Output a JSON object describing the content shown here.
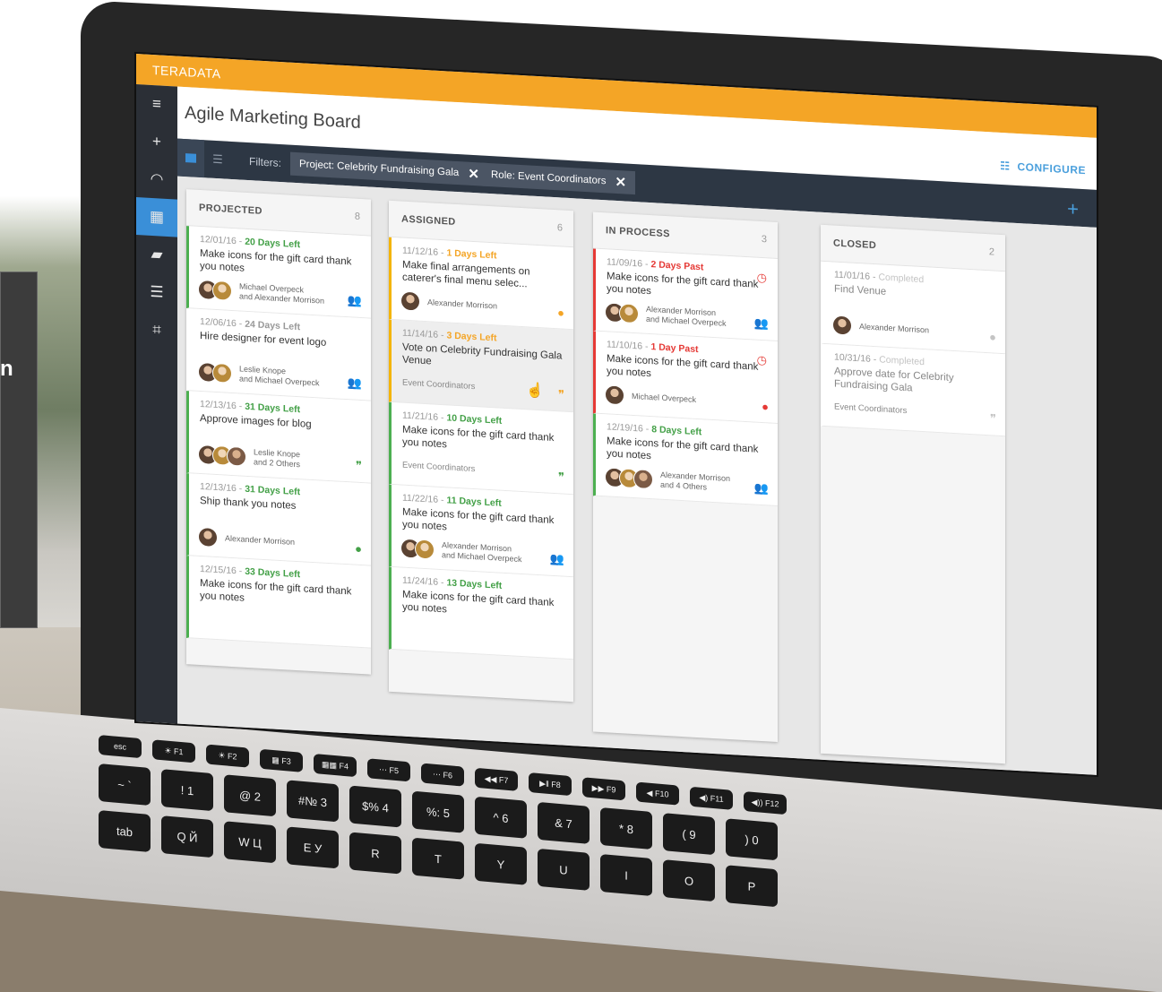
{
  "app": {
    "brand": "TERADATA",
    "board_title": "Agile Marketing Board",
    "configure_label": "CONFIGURE"
  },
  "colors": {
    "brand": "#f4a526",
    "accent": "#4a9fdc",
    "toolbar": "#2d3744",
    "sidebar": "#2b2f36",
    "green": "#4caf50",
    "yellow": "#f4b400",
    "red": "#e53935"
  },
  "promo": {
    "letter": "n"
  },
  "sidebar": {
    "items": [
      {
        "icon": "menu-icon",
        "glyph": "≡"
      },
      {
        "icon": "plus-icon",
        "glyph": "+"
      },
      {
        "icon": "dashboard-gauge-icon",
        "glyph": "◠"
      },
      {
        "icon": "board-icon",
        "glyph": "▦",
        "active": true
      },
      {
        "icon": "chat-icon",
        "glyph": "▰"
      },
      {
        "icon": "sliders-icon",
        "glyph": "☰"
      },
      {
        "icon": "crop-icon",
        "glyph": "⌗"
      }
    ]
  },
  "toolbar": {
    "filters_label": "Filters:",
    "chips": [
      {
        "label": "Project: Celebrity Fundraising Gala"
      },
      {
        "label": "Role: Event Coordinators"
      }
    ],
    "add_glyph": "+"
  },
  "columns": [
    {
      "title": "PROJECTED",
      "count": "8",
      "cards": [
        {
          "date": "12/01/16 - ",
          "due": "20 Days Left",
          "due_color": "green",
          "border": "green",
          "title": "Make icons for the gift card thank you notes",
          "people": "Michael Overpeck",
          "people2": "and Alexander Morrison",
          "avatars": 2,
          "icon": "group-icon",
          "glyph": "👥",
          "icon_color": "#43a047"
        },
        {
          "date": "12/06/16 - ",
          "due": "24 Days Left",
          "due_color": "gray-dark",
          "border": "gray",
          "title": "Hire designer for event logo",
          "people": "Leslie Knope",
          "people2": "and Michael Overpeck",
          "avatars": 2,
          "icon": "group-icon",
          "glyph": "👥",
          "icon_color": "#43a047"
        },
        {
          "date": "12/13/16 - ",
          "due": "31 Days Left",
          "due_color": "green",
          "border": "green",
          "title": "Approve images for blog",
          "people": "Leslie Knope",
          "people2": "and 2 Others",
          "avatars": 3,
          "icon": "quote-icon",
          "glyph": "❞",
          "icon_color": "#43a047"
        },
        {
          "date": "12/13/16 - ",
          "due": "31 Days Left",
          "due_color": "green",
          "border": "green",
          "title": "Ship thank you notes",
          "people": "Alexander Morrison",
          "people2": "",
          "avatars": 1,
          "icon": "person-icon",
          "glyph": "●",
          "icon_color": "#43a047"
        },
        {
          "date": "12/15/16 - ",
          "due": "33 Days Left",
          "due_color": "green",
          "border": "green",
          "title": "Make icons for the gift card thank you notes",
          "people": "",
          "people2": "",
          "avatars": 0,
          "icon": "",
          "glyph": "",
          "icon_color": "#43a047"
        }
      ]
    },
    {
      "title": "ASSIGNED",
      "count": "6",
      "cards": [
        {
          "date": "11/12/16 - ",
          "due": "1 Days Left",
          "due_color": "yellow",
          "border": "yellow",
          "title": "Make final arrangements on caterer's final menu selec...",
          "people": "Alexander Morrison",
          "people2": "",
          "avatars": 1,
          "icon": "person-icon",
          "glyph": "●",
          "icon_color": "#f4a526"
        },
        {
          "date": "11/14/16 - ",
          "due": "3 Days Left",
          "due_color": "yellow",
          "border": "yellow",
          "title": "Vote on Celebrity Fundraising Gala Venue",
          "role": "Event Coordinators",
          "avatars": 0,
          "icon": "quote-icon",
          "glyph": "❞",
          "icon_color": "#f4a526",
          "highlight": true
        },
        {
          "date": "11/21/16 - ",
          "due": "10 Days Left",
          "due_color": "green",
          "border": "green",
          "title": "Make icons for the gift card thank you notes",
          "role": "Event Coordinators",
          "avatars": 0,
          "icon": "quote-icon",
          "glyph": "❞",
          "icon_color": "#43a047"
        },
        {
          "date": "11/22/16 - ",
          "due": "11 Days Left",
          "due_color": "green",
          "border": "green",
          "title": "Make icons for the gift card thank you notes",
          "people": "Alexander Morrison",
          "people2": "and Michael Overpeck",
          "avatars": 2,
          "icon": "group-icon",
          "glyph": "👥",
          "icon_color": "#43a047"
        },
        {
          "date": "11/24/16 - ",
          "due": "13 Days Left",
          "due_color": "green",
          "border": "green",
          "title": "Make icons for the gift card thank you notes",
          "avatars": 0,
          "icon": "",
          "glyph": "",
          "icon_color": "#43a047"
        }
      ]
    },
    {
      "title": "IN PROCESS",
      "count": "3",
      "cards": [
        {
          "date": "11/09/16 - ",
          "due": "2 Days Past",
          "due_color": "red",
          "border": "red",
          "title": "Make icons for the gift card thank you notes",
          "people": "Alexander Morrison",
          "people2": "and Michael Overpeck",
          "avatars": 2,
          "icon": "group-icon",
          "glyph": "👥",
          "icon_color": "#e53935",
          "status": "clock-icon"
        },
        {
          "date": "11/10/16 - ",
          "due": "1 Day Past",
          "due_color": "red",
          "border": "red",
          "title": "Make icons for the gift card thank you notes",
          "people": "Michael Overpeck",
          "people2": "",
          "avatars": 1,
          "icon": "person-icon",
          "glyph": "●",
          "icon_color": "#e53935",
          "status": "clock-icon"
        },
        {
          "date": "12/19/16 - ",
          "due": "8 Days Left",
          "due_color": "green",
          "border": "green",
          "title": "Make icons for the gift card thank you notes",
          "people": "Alexander Morrison",
          "people2": "and 4 Others",
          "avatars": 3,
          "icon": "group-icon",
          "glyph": "👥",
          "icon_color": "#43a047"
        }
      ]
    },
    {
      "title": "CLOSED",
      "count": "2",
      "cards": [
        {
          "date": "11/01/16 - ",
          "due": "Completed",
          "due_color": "gray",
          "border": "gray",
          "title": "Find Venue",
          "people": "Alexander Morrison",
          "people2": "",
          "avatars": 1,
          "icon": "person-icon",
          "glyph": "●",
          "icon_color": "#c4c4c4",
          "closed": true
        },
        {
          "date": "10/31/16 - ",
          "due": "Completed",
          "due_color": "gray",
          "border": "gray",
          "title": "Approve date for Celebrity Fundraising Gala",
          "role": "Event Coordinators",
          "avatars": 0,
          "icon": "quote-icon",
          "glyph": "❞",
          "icon_color": "#c4c4c4",
          "closed": true
        }
      ]
    }
  ],
  "keyboard": {
    "row1": [
      "esc",
      "☀ F1",
      "☀ F2",
      "▦ F3",
      "▦▦ F4",
      "⋯ F5",
      "⋯ F6",
      "◀◀ F7",
      "▶‖ F8",
      "▶▶ F9",
      "◀ F10",
      "◀) F11",
      "◀)) F12"
    ],
    "row2": [
      "~ `",
      "! 1",
      "@ 2",
      "#№ 3",
      "$% 4",
      "%: 5",
      "^ 6",
      "& 7",
      "* 8",
      "( 9",
      ") 0"
    ],
    "row3": [
      "tab",
      "Q Й",
      "W Ц",
      "E У",
      "R",
      "T",
      "Y",
      "U",
      "I",
      "O",
      "P"
    ]
  }
}
